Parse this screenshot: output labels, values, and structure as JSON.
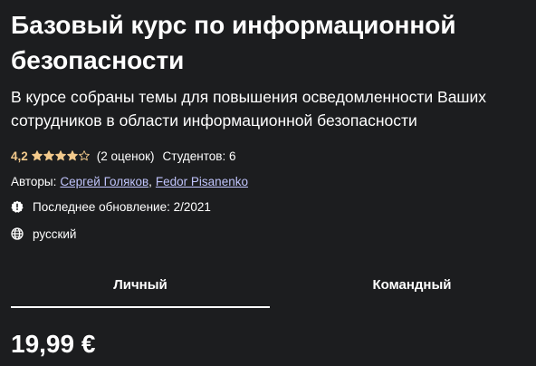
{
  "course": {
    "title": "Базовый курс по информационной безопасности",
    "subtitle": "В курсе собраны темы для повышения осведомленности Ваших сотрудников в области информационной безопасности",
    "rating": {
      "value": "4,2",
      "stars": 4.2,
      "count_label": "(2 оценок)",
      "star_color": "#f3ca8c"
    },
    "students_label": "Студентов: 6",
    "authors": {
      "label": "Авторы:",
      "names": [
        "Сергей Голяков",
        "Fedor Pisanenko"
      ],
      "separator": ",",
      "link_color": "#c0c4fc"
    },
    "last_updated": {
      "icon": "alert-badge-icon",
      "label": "Последнее обновление: 2/2021"
    },
    "language": {
      "icon": "globe-icon",
      "label": "русский"
    }
  },
  "tabs": [
    {
      "label": "Личный",
      "active": true
    },
    {
      "label": "Командный",
      "active": false
    }
  ],
  "pricing": {
    "price": "19,99 €"
  },
  "theme": {
    "background": "#1c1d1f",
    "text": "#ffffff"
  }
}
